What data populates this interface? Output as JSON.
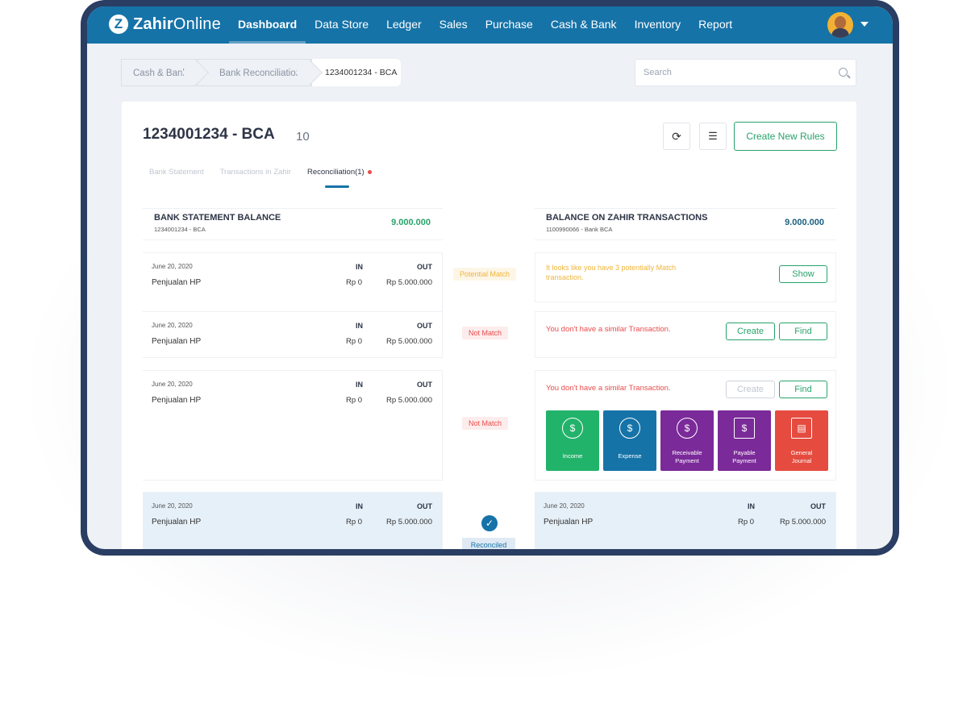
{
  "nav": {
    "logo_letter": "Z",
    "logo_bold": "Zahir",
    "logo_light": "Online",
    "items": [
      "Dashboard",
      "Data Store",
      "Ledger",
      "Sales",
      "Purchase",
      "Cash & Bank",
      "Inventory",
      "Report"
    ],
    "active": "Dashboard"
  },
  "breadcrumb": [
    "Cash & Bank",
    "Bank Reconciliation",
    "1234001234 - BCA"
  ],
  "search": {
    "placeholder": "Search"
  },
  "header": {
    "title": "1234001234 - BCA",
    "count": "10",
    "create_rules": "Create New Rules"
  },
  "tabs": [
    "Bank Statement",
    "Transactions in Zahir",
    "Reconciliation(1)"
  ],
  "left_balance": {
    "label": "BANK STATEMENT BALANCE",
    "sub": "1234001234 - BCA",
    "amount": "9.000.000"
  },
  "right_balance": {
    "label": "BALANCE ON ZAHIR TRANSACTIONS",
    "sub": "1100990066 - Bank BCA",
    "amount": "9.000.000"
  },
  "rows": [
    {
      "date": "June 20, 2020",
      "in_label": "IN",
      "out_label": "OUT",
      "desc": "Penjualan HP",
      "in": "Rp 0",
      "out": "Rp 5.000.000"
    },
    {
      "date": "June 20, 2020",
      "in_label": "IN",
      "out_label": "OUT",
      "desc": "Penjualan HP",
      "in": "Rp 0",
      "out": "Rp 5.000.000"
    },
    {
      "date": "June 20, 2020",
      "in_label": "IN",
      "out_label": "OUT",
      "desc": "Penjualan HP",
      "in": "Rp 0",
      "out": "Rp 5.000.000"
    },
    {
      "date": "June 20, 2020",
      "in_label": "IN",
      "out_label": "OUT",
      "desc": "Penjualan HP",
      "in": "Rp 0",
      "out": "Rp 5.000.000"
    }
  ],
  "statuses": {
    "potential": "Potential Match",
    "not_match": "Not Match",
    "reconciled": "Reconciled"
  },
  "right": {
    "potential_msg": "It looks like you have 3 potentially Match transaction.",
    "show": "Show",
    "no_similar": "You don't have a similar Transaction.",
    "create": "Create",
    "find": "Find",
    "tiles": [
      {
        "label": "Income",
        "color": "#22b36b",
        "icon": "hand-money-icon"
      },
      {
        "label": "Expense",
        "color": "#1673a8",
        "icon": "hand-pay-icon"
      },
      {
        "label": "Receivable Payment",
        "color": "#7b2a99",
        "icon": "calculator-money-icon"
      },
      {
        "label": "Payable Payment",
        "color": "#7b2a99",
        "icon": "invoice-icon"
      },
      {
        "label": "General Journal",
        "color": "#e54b3f",
        "icon": "journal-icon"
      }
    ],
    "matched": {
      "date": "June 20, 2020",
      "in_label": "IN",
      "out_label": "OUT",
      "desc": "Penjualan HP",
      "in": "Rp 0",
      "out": "Rp 5.000.000"
    }
  },
  "colors": {
    "brand": "#1673a8",
    "green": "#27a36b",
    "red": "#e84c4c",
    "amber": "#f0b53a"
  }
}
